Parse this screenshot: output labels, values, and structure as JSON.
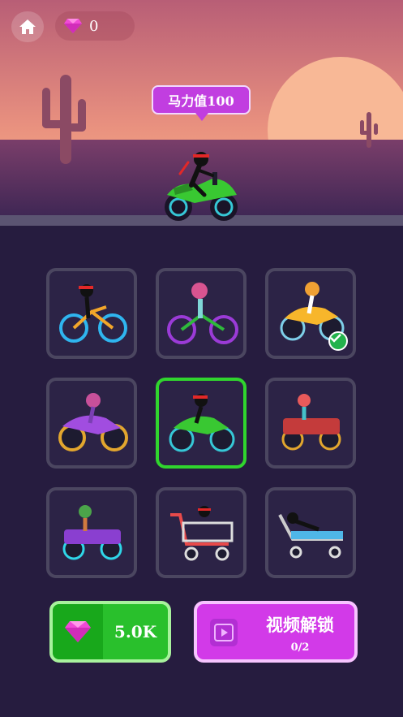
{
  "header": {
    "gem_count": "0"
  },
  "tooltip": {
    "label": "马力值100"
  },
  "vehicles": [
    {
      "name": "ninja-bicycle",
      "state": "default"
    },
    {
      "name": "pink-helmet-bicycle",
      "state": "default"
    },
    {
      "name": "orange-dirtbike",
      "state": "owned"
    },
    {
      "name": "purple-motocross",
      "state": "default"
    },
    {
      "name": "green-motorbike",
      "state": "selected"
    },
    {
      "name": "red-atv",
      "state": "default"
    },
    {
      "name": "purple-atv",
      "state": "default"
    },
    {
      "name": "shopping-cart",
      "state": "default"
    },
    {
      "name": "hospital-bed",
      "state": "default"
    }
  ],
  "buy_button": {
    "price": "5.0K"
  },
  "video_button": {
    "title": "视频解锁",
    "progress": "0/2"
  },
  "colors": {
    "selected_border": "#30d52e",
    "tile_border": "#4b4660",
    "background": "#261c3f",
    "buy_green": "#29c02c",
    "video_purple": "#d23ae8",
    "tooltip_purple": "#c13ee0"
  }
}
